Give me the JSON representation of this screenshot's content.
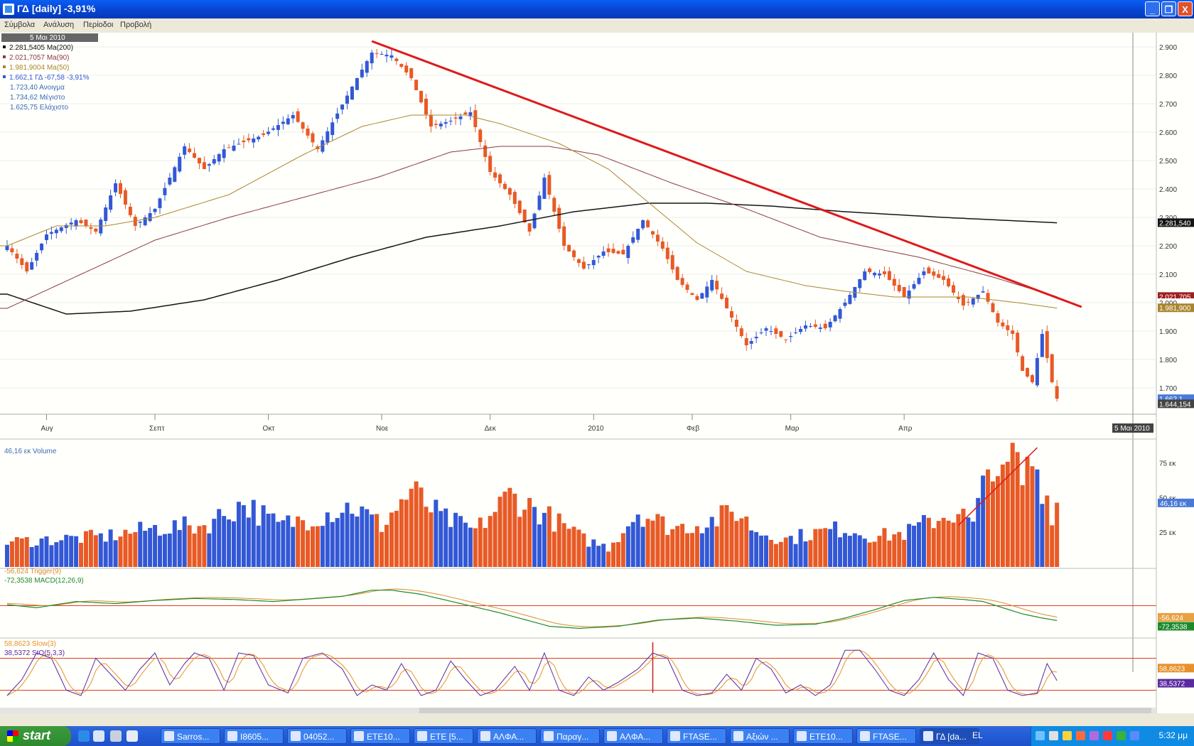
{
  "window": {
    "title": "ΓΔ [daily] -3,91%",
    "controls": {
      "minimize": "_",
      "maximize": "❐",
      "close": "X"
    }
  },
  "menu": {
    "items": [
      "Σύμβολα",
      "Ανάλυση",
      "Περίοδοι",
      "Προβολή"
    ]
  },
  "toolbar": {
    "icons": [
      "pointer-icon",
      "crosshair-icon",
      "rectangle-icon",
      "line-icon",
      "hlines-icon",
      "print-icon",
      "save-icon"
    ]
  },
  "colors": {
    "up": "#3358d6",
    "down": "#e85a26",
    "ma200": "#141414",
    "ma90": "#8a3a46",
    "ma50": "#a9862e",
    "trend": "#dd1a1a",
    "macd": "#1e8a2c",
    "trigger": "#d88b2e",
    "sto": "#5a2aa0",
    "slow": "#e8902a",
    "ref": "#d94020"
  },
  "chart_data": [
    {
      "type": "candlestick",
      "symbol": "ΓΔ",
      "date_header": "5 Μαι 2010",
      "legend": [
        {
          "text": "2.281,5405 Ma(200)",
          "color": "#141414"
        },
        {
          "text": "2.021,7057 Ma(90)",
          "color": "#8a3a46"
        },
        {
          "text": "1.981,9004 Ma(50)",
          "color": "#a9862e"
        },
        {
          "text": "1.662,1 ΓΔ -67,58 -3,91%",
          "color": "#3358d6"
        },
        {
          "text": "1.723,40 Ανοιγμα",
          "color": "#3a6bb8"
        },
        {
          "text": "1.734,62 Μέγιστο",
          "color": "#3a6bb8"
        },
        {
          "text": "1.625,75 Ελάχιστο",
          "color": "#3a6bb8"
        }
      ],
      "y_ticks": [
        "2.900",
        "2.800",
        "2.700",
        "2.600",
        "2.500",
        "2.400",
        "2.300",
        "2.200",
        "2.100",
        "2.000",
        "1.900",
        "1.800",
        "1.700"
      ],
      "ylim": [
        1620,
        2950
      ],
      "x_month_labels": [
        {
          "label": "Αυγ",
          "index": 8
        },
        {
          "label": "Σεπτ",
          "index": 30
        },
        {
          "label": "Οκτ",
          "index": 53
        },
        {
          "label": "Νοε",
          "index": 76
        },
        {
          "label": "Δεκ",
          "index": 98
        },
        {
          "label": "2010",
          "index": 119
        },
        {
          "label": "Φεβ",
          "index": 139
        },
        {
          "label": "Μαρ",
          "index": 159
        },
        {
          "label": "Απρ",
          "index": 182
        }
      ],
      "x_last_label": "5 Μαι 2010",
      "close_anchors": [
        [
          0,
          2200
        ],
        [
          4,
          2110
        ],
        [
          8,
          2240
        ],
        [
          14,
          2290
        ],
        [
          18,
          2250
        ],
        [
          22,
          2420
        ],
        [
          26,
          2270
        ],
        [
          30,
          2330
        ],
        [
          36,
          2550
        ],
        [
          40,
          2470
        ],
        [
          44,
          2540
        ],
        [
          52,
          2590
        ],
        [
          58,
          2660
        ],
        [
          63,
          2540
        ],
        [
          70,
          2760
        ],
        [
          74,
          2880
        ],
        [
          78,
          2870
        ],
        [
          82,
          2790
        ],
        [
          86,
          2620
        ],
        [
          90,
          2640
        ],
        [
          94,
          2670
        ],
        [
          98,
          2460
        ],
        [
          102,
          2380
        ],
        [
          106,
          2250
        ],
        [
          109,
          2440
        ],
        [
          113,
          2200
        ],
        [
          117,
          2120
        ],
        [
          121,
          2180
        ],
        [
          125,
          2170
        ],
        [
          129,
          2290
        ],
        [
          133,
          2190
        ],
        [
          136,
          2080
        ],
        [
          140,
          2010
        ],
        [
          143,
          2080
        ],
        [
          146,
          1980
        ],
        [
          150,
          1850
        ],
        [
          154,
          1910
        ],
        [
          158,
          1870
        ],
        [
          162,
          1920
        ],
        [
          166,
          1910
        ],
        [
          170,
          2000
        ],
        [
          174,
          2110
        ],
        [
          178,
          2100
        ],
        [
          182,
          2020
        ],
        [
          186,
          2110
        ],
        [
          190,
          2080
        ],
        [
          194,
          1990
        ],
        [
          198,
          2040
        ],
        [
          201,
          1930
        ],
        [
          204,
          1890
        ],
        [
          206,
          1760
        ],
        [
          208,
          1720
        ],
        [
          210,
          1890
        ],
        [
          212,
          1720
        ],
        [
          213,
          1662
        ]
      ],
      "series": [
        {
          "name": "Ma(200)",
          "label": "2.281,540",
          "anchors": [
            [
              0,
              2030
            ],
            [
              12,
              1960
            ],
            [
              25,
              1970
            ],
            [
              40,
              2010
            ],
            [
              55,
              2080
            ],
            [
              70,
              2160
            ],
            [
              85,
              2230
            ],
            [
              100,
              2270
            ],
            [
              115,
              2320
            ],
            [
              130,
              2350
            ],
            [
              142,
              2350
            ],
            [
              155,
              2340
            ],
            [
              170,
              2320
            ],
            [
              190,
              2300
            ],
            [
              213,
              2281
            ]
          ]
        },
        {
          "name": "Ma(90)",
          "label": "2.021,705",
          "anchors": [
            [
              0,
              1980
            ],
            [
              15,
              2100
            ],
            [
              30,
              2220
            ],
            [
              45,
              2300
            ],
            [
              60,
              2370
            ],
            [
              75,
              2440
            ],
            [
              90,
              2530
            ],
            [
              100,
              2550
            ],
            [
              110,
              2550
            ],
            [
              120,
              2520
            ],
            [
              135,
              2420
            ],
            [
              150,
              2330
            ],
            [
              165,
              2230
            ],
            [
              185,
              2160
            ],
            [
              200,
              2090
            ],
            [
              213,
              2021
            ]
          ]
        },
        {
          "name": "Ma(50)",
          "label": "1.981,900",
          "anchors": [
            [
              0,
              2200
            ],
            [
              10,
              2270
            ],
            [
              20,
              2270
            ],
            [
              30,
              2300
            ],
            [
              45,
              2380
            ],
            [
              60,
              2520
            ],
            [
              72,
              2620
            ],
            [
              82,
              2660
            ],
            [
              93,
              2660
            ],
            [
              100,
              2630
            ],
            [
              112,
              2560
            ],
            [
              122,
              2470
            ],
            [
              131,
              2340
            ],
            [
              140,
              2210
            ],
            [
              150,
              2110
            ],
            [
              162,
              2060
            ],
            [
              170,
              2040
            ],
            [
              180,
              2020
            ],
            [
              195,
              2020
            ],
            [
              205,
              2000
            ],
            [
              213,
              1981
            ]
          ]
        },
        {
          "name": "trendline",
          "points": [
            [
              74,
              2920
            ],
            [
              218,
              1985
            ]
          ]
        }
      ],
      "price_labels": [
        "2.281,540",
        "2.021,705",
        "2.000",
        "1.981,900",
        "1.662,1",
        "1.644,154"
      ]
    },
    {
      "type": "bar",
      "title": "46,16 εκ Volume",
      "y_ticks": [
        "75 εκ",
        "50 εκ",
        "25 εκ"
      ],
      "last_label": "46,16 εκ",
      "ylim": [
        0,
        85
      ],
      "anchors": [
        [
          0,
          18
        ],
        [
          10,
          20
        ],
        [
          20,
          22
        ],
        [
          30,
          28
        ],
        [
          40,
          30
        ],
        [
          48,
          46
        ],
        [
          55,
          30
        ],
        [
          62,
          36
        ],
        [
          70,
          44
        ],
        [
          76,
          30
        ],
        [
          82,
          55
        ],
        [
          88,
          36
        ],
        [
          95,
          26
        ],
        [
          102,
          52
        ],
        [
          110,
          36
        ],
        [
          117,
          20
        ],
        [
          122,
          14
        ],
        [
          128,
          40
        ],
        [
          135,
          28
        ],
        [
          142,
          32
        ],
        [
          148,
          40
        ],
        [
          152,
          26
        ],
        [
          158,
          20
        ],
        [
          163,
          24
        ],
        [
          170,
          28
        ],
        [
          176,
          22
        ],
        [
          182,
          24
        ],
        [
          188,
          34
        ],
        [
          193,
          40
        ],
        [
          196,
          30
        ],
        [
          200,
          82
        ],
        [
          202,
          60
        ],
        [
          204,
          80
        ],
        [
          206,
          62
        ],
        [
          208,
          78
        ],
        [
          210,
          60
        ],
        [
          212,
          40
        ],
        [
          213,
          46
        ]
      ],
      "trend_points": [
        [
          193,
          30
        ],
        [
          209,
          86
        ]
      ]
    },
    {
      "type": "line",
      "series": [
        {
          "name": "Trigger(9)",
          "label": "-56,624",
          "legend": "-56,624 Trigger(9)",
          "color": "#d88b2e"
        },
        {
          "name": "MACD(12,26,9)",
          "label": "-72,3538",
          "legend": "-72,3538 MACD(12,26,9)",
          "color": "#1e8a2c"
        }
      ],
      "ylim": [
        -150,
        160
      ],
      "zero_line": 0,
      "macd_anchors": [
        [
          0,
          5
        ],
        [
          6,
          -10
        ],
        [
          14,
          20
        ],
        [
          22,
          10
        ],
        [
          30,
          25
        ],
        [
          38,
          35
        ],
        [
          46,
          30
        ],
        [
          54,
          20
        ],
        [
          60,
          30
        ],
        [
          68,
          45
        ],
        [
          74,
          75
        ],
        [
          78,
          75
        ],
        [
          84,
          55
        ],
        [
          92,
          10
        ],
        [
          100,
          -35
        ],
        [
          110,
          -100
        ],
        [
          116,
          -110
        ],
        [
          124,
          -100
        ],
        [
          132,
          -70
        ],
        [
          140,
          -60
        ],
        [
          148,
          -75
        ],
        [
          156,
          -95
        ],
        [
          164,
          -90
        ],
        [
          170,
          -60
        ],
        [
          176,
          -20
        ],
        [
          182,
          25
        ],
        [
          188,
          40
        ],
        [
          194,
          30
        ],
        [
          198,
          20
        ],
        [
          202,
          -10
        ],
        [
          206,
          -40
        ],
        [
          210,
          -60
        ],
        [
          213,
          -72
        ]
      ]
    },
    {
      "type": "line",
      "series": [
        {
          "name": "Slow(3)",
          "label": "58,8623",
          "legend": "58,8623 Slow(3)",
          "color": "#e8902a"
        },
        {
          "name": "StO(5,3,3)",
          "label": "38,5372",
          "legend": "38,5372 StO(5,3,3)",
          "color": "#5a2aa0"
        }
      ],
      "ylim": [
        -10,
        110
      ],
      "ref_lines": [
        80,
        20
      ],
      "sto_anchors": [
        [
          0,
          10
        ],
        [
          3,
          40
        ],
        [
          6,
          90
        ],
        [
          9,
          80
        ],
        [
          12,
          20
        ],
        [
          15,
          10
        ],
        [
          18,
          80
        ],
        [
          21,
          50
        ],
        [
          24,
          20
        ],
        [
          27,
          60
        ],
        [
          30,
          90
        ],
        [
          33,
          30
        ],
        [
          36,
          70
        ],
        [
          38,
          90
        ],
        [
          41,
          80
        ],
        [
          44,
          20
        ],
        [
          47,
          90
        ],
        [
          50,
          85
        ],
        [
          53,
          30
        ],
        [
          57,
          15
        ],
        [
          60,
          80
        ],
        [
          64,
          90
        ],
        [
          68,
          60
        ],
        [
          71,
          10
        ],
        [
          74,
          30
        ],
        [
          77,
          20
        ],
        [
          80,
          70
        ],
        [
          84,
          10
        ],
        [
          87,
          20
        ],
        [
          90,
          75
        ],
        [
          93,
          40
        ],
        [
          96,
          10
        ],
        [
          99,
          20
        ],
        [
          103,
          65
        ],
        [
          106,
          20
        ],
        [
          109,
          90
        ],
        [
          112,
          20
        ],
        [
          115,
          10
        ],
        [
          118,
          45
        ],
        [
          121,
          20
        ],
        [
          124,
          35
        ],
        [
          128,
          60
        ],
        [
          131,
          90
        ],
        [
          134,
          80
        ],
        [
          137,
          20
        ],
        [
          140,
          10
        ],
        [
          143,
          15
        ],
        [
          146,
          50
        ],
        [
          149,
          20
        ],
        [
          152,
          80
        ],
        [
          155,
          60
        ],
        [
          158,
          15
        ],
        [
          161,
          30
        ],
        [
          164,
          10
        ],
        [
          167,
          30
        ],
        [
          170,
          95
        ],
        [
          173,
          95
        ],
        [
          176,
          60
        ],
        [
          179,
          20
        ],
        [
          182,
          10
        ],
        [
          185,
          40
        ],
        [
          188,
          90
        ],
        [
          191,
          40
        ],
        [
          194,
          10
        ],
        [
          197,
          90
        ],
        [
          200,
          80
        ],
        [
          203,
          20
        ],
        [
          206,
          10
        ],
        [
          209,
          15
        ],
        [
          211,
          70
        ],
        [
          213,
          38
        ]
      ]
    }
  ],
  "taskbar": {
    "start_label": "start",
    "tasks": [
      "Sarros...",
      "I8605...",
      "04052...",
      "ETE10...",
      "ETE [5...",
      "ΑΛΦΑ...",
      "Παραγ...",
      "ΑΛΦΑ...",
      "FTASE...",
      "Αξιών ...",
      "ETE10...",
      "FTASE...",
      "ΓΔ [da..."
    ],
    "lang": "EL",
    "clock": "5:32 μμ"
  }
}
